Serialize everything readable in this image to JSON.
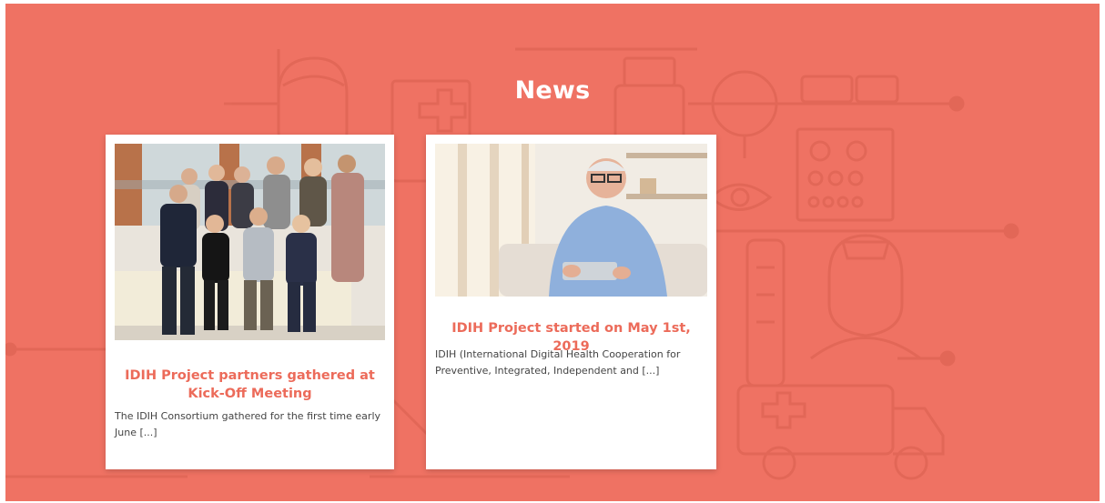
{
  "section": {
    "title": "News"
  },
  "colors": {
    "background": "#ef7263",
    "accent": "#ec6b5a",
    "card": "#ffffff"
  },
  "background_icons": [
    "face-icon",
    "clipboard-cross-icon",
    "medicine-bottle-icon",
    "magnifier-icon",
    "glasses-icon",
    "eye-chart-icon",
    "eye-icon",
    "thermometer-icon",
    "nurse-icon",
    "ambulance-icon"
  ],
  "news": [
    {
      "title": "IDIH Project partners gathered at Kick-Off Meeting",
      "excerpt": "The IDIH Consortium gathered for the first time early June [...]",
      "image": "group-photo"
    },
    {
      "title": "IDIH Project started on May 1st, 2019",
      "excerpt": "IDIH (International Digital Health Cooperation for Preventive, Integrated, Independent and [...]",
      "image": "senior-man-photo"
    }
  ]
}
